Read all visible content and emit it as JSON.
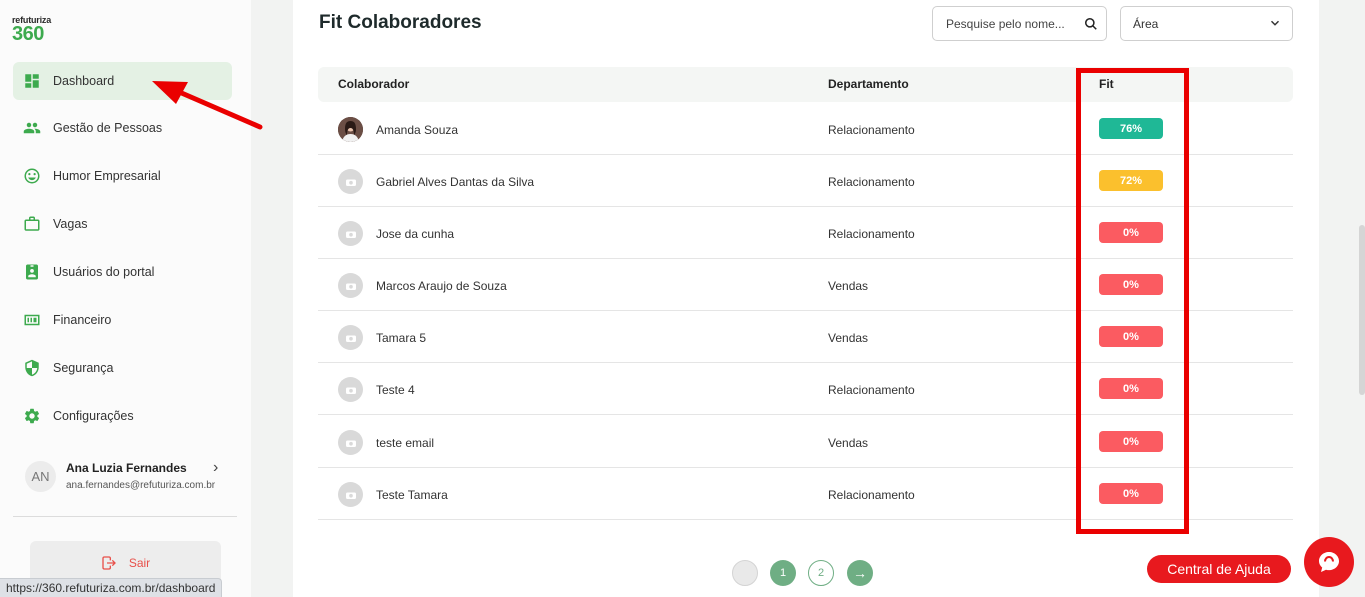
{
  "logo": {
    "small": "refuturiza",
    "big": "360"
  },
  "sidebar": {
    "items": [
      {
        "label": "Dashboard",
        "icon": "dashboard-icon",
        "active": true
      },
      {
        "label": "Gestão de Pessoas",
        "icon": "people-icon"
      },
      {
        "label": "Humor Empresarial",
        "icon": "smiley-icon"
      },
      {
        "label": "Vagas",
        "icon": "briefcase-icon"
      },
      {
        "label": "Usuários do portal",
        "icon": "badge-icon"
      },
      {
        "label": "Financeiro",
        "icon": "money-icon"
      },
      {
        "label": "Segurança",
        "icon": "shield-icon"
      },
      {
        "label": "Configurações",
        "icon": "gear-icon"
      }
    ],
    "user": {
      "initials": "AN",
      "name": "Ana Luzia Fernandes",
      "email": "ana.fernandes@refuturiza.com.br"
    },
    "logout_label": "Sair"
  },
  "status_url": "https://360.refuturiza.com.br/dashboard",
  "main": {
    "title": "Fit Colaboradores",
    "search": {
      "placeholder": "Pesquise pelo nome..."
    },
    "area_select": {
      "value": "Área"
    },
    "columns": [
      "Colaborador",
      "Departamento",
      "Fit"
    ],
    "rows": [
      {
        "name": "Amanda Souza",
        "department": "Relacionamento",
        "fit": "76%",
        "fit_color": "#1fb896",
        "photo": true
      },
      {
        "name": "Gabriel Alves Dantas da Silva",
        "department": "Relacionamento",
        "fit": "72%",
        "fit_color": "#fbc02d"
      },
      {
        "name": "Jose da cunha",
        "department": "Relacionamento",
        "fit": "0%",
        "fit_color": "#fb5b61"
      },
      {
        "name": "Marcos Araujo de Souza",
        "department": "Vendas",
        "fit": "0%",
        "fit_color": "#fb5b61"
      },
      {
        "name": "Tamara 5",
        "department": "Vendas",
        "fit": "0%",
        "fit_color": "#fb5b61"
      },
      {
        "name": "Teste 4",
        "department": "Relacionamento",
        "fit": "0%",
        "fit_color": "#fb5b61"
      },
      {
        "name": "teste email",
        "department": "Vendas",
        "fit": "0%",
        "fit_color": "#fb5b61"
      },
      {
        "name": "Teste Tamara",
        "department": "Relacionamento",
        "fit": "0%",
        "fit_color": "#fb5b61"
      }
    ],
    "pagination": {
      "pages": [
        "1",
        "2"
      ],
      "current": "1",
      "next": "→"
    }
  },
  "help_button": "Central de Ajuda",
  "colors": {
    "brand_green": "#3daa4e",
    "highlight_red": "#ea0000",
    "help_red": "#e8191e"
  }
}
